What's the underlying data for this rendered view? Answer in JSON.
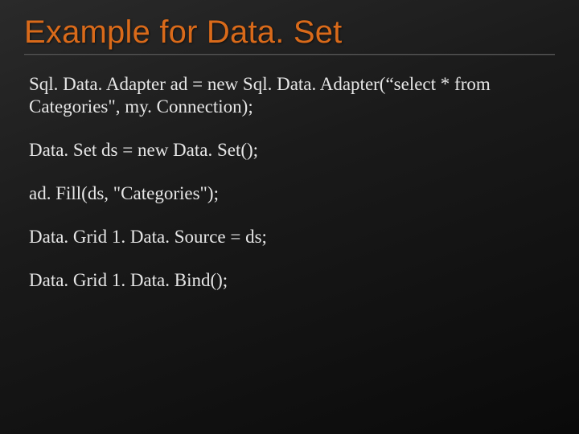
{
  "slide": {
    "title": "Example for Data. Set",
    "code": {
      "line1": "Sql. Data. Adapter ad = new Sql. Data. Adapter(“select * from Categories\", my. Connection);",
      "line2": "Data. Set ds = new Data. Set();",
      "line3": "ad. Fill(ds, \"Categories\");",
      "line4": "Data. Grid 1. Data. Source = ds;",
      "line5": "Data. Grid 1. Data. Bind();"
    }
  }
}
